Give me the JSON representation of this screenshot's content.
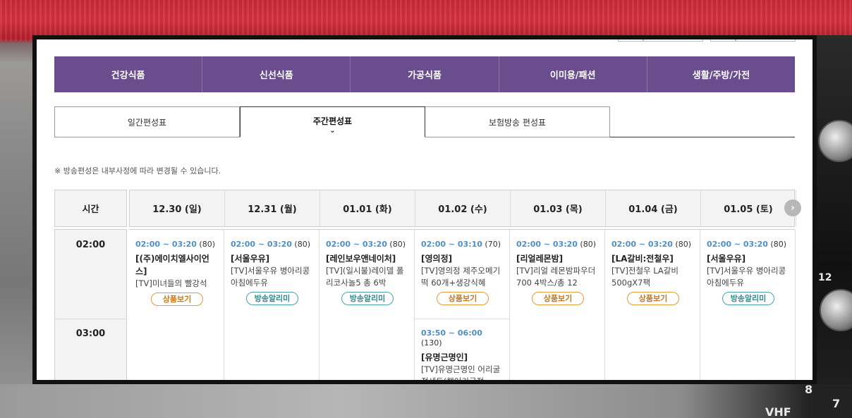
{
  "category_nav": [
    "건강식품",
    "신선식품",
    "가공식품",
    "이미용/패션",
    "생활/주방/가전"
  ],
  "tabs": [
    {
      "label": "일간편성표",
      "active": false
    },
    {
      "label": "주간편성표",
      "active": true
    },
    {
      "label": "보험방송 편성표",
      "active": false
    }
  ],
  "notice": "※ 방송편성은 내부사정에 따라 변경될 수 있습니다.",
  "schedule": {
    "time_header": "시간",
    "days": [
      "12.30 (일)",
      "12.31 (월)",
      "01.01 (화)",
      "01.02 (수)",
      "01.03 (목)",
      "01.04 (금)",
      "01.05 (토)"
    ],
    "time_slots": [
      "02:00",
      "03:00"
    ],
    "next_icon": "chevron-right-icon",
    "programs": [
      {
        "time": "02:00 ~ 03:20",
        "duration": "(80)",
        "brand": "[(주)에이치엘사이언스]",
        "desc": "[TV]미녀들의 빨강석",
        "button": "상품보기",
        "button_type": "product"
      },
      {
        "time": "02:00 ~ 03:20",
        "duration": "(80)",
        "brand": "[서울우유]",
        "desc": "[TV]서울우유 병아리콩 아침에두유",
        "button": "방송알리미",
        "button_type": "alarm"
      },
      {
        "time": "02:00 ~ 03:20",
        "duration": "(80)",
        "brand": "[레인보우앤네이처]",
        "desc": "[TV](일시불)레이델 폴리코사놀5 총 6박",
        "button": "방송알리미",
        "button_type": "alarm"
      },
      {
        "time": "02:00 ~ 03:10",
        "duration": "(70)",
        "brand": "[영의정]",
        "desc": "[TV]영의정 제주오메기떡 60개+생강식혜",
        "button": "상품보기",
        "button_type": "product"
      },
      {
        "time": "02:00 ~ 03:20",
        "duration": "(80)",
        "brand": "[리얼레몬밤]",
        "desc": "[TV]리얼 레몬밤파우더 700 4박스/총 12",
        "button": "상품보기",
        "button_type": "product"
      },
      {
        "time": "02:00 ~ 03:20",
        "duration": "(80)",
        "brand": "[LA갈비:전철우]",
        "desc": "[TV]전철우 LA갈비 500gX7팩",
        "button": "상품보기",
        "button_type": "product"
      },
      {
        "time": "02:00 ~ 03:20",
        "duration": "(80)",
        "brand": "[서울우유]",
        "desc": "[TV]서울우유 병아리콩 아침에두유",
        "button": "방송알리미",
        "button_type": "alarm"
      }
    ],
    "second_program": {
      "time": "03:50 ~ 06:00",
      "duration": "(130)",
      "brand": "[유명근명인]",
      "desc": "[TV]유명근명인 어리굴젓세트(햇어리굴젓"
    }
  },
  "background_labels": [
    "8",
    "7",
    "VHF",
    "12"
  ]
}
